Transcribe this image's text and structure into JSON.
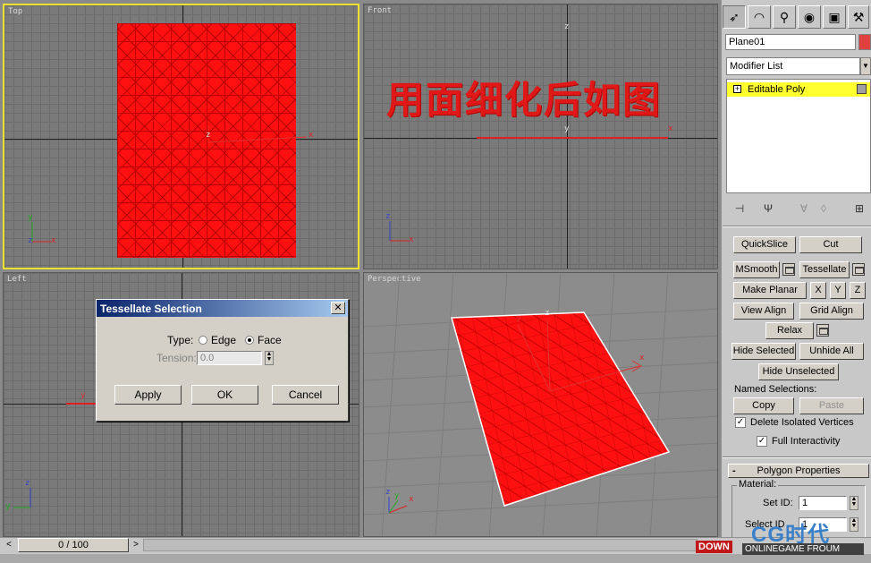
{
  "viewports": {
    "top": {
      "label": "Top"
    },
    "front": {
      "label": "Front"
    },
    "left": {
      "label": "Left"
    },
    "perspective": {
      "label": "Perspective"
    }
  },
  "axes": {
    "x": "x",
    "y": "y",
    "z": "z"
  },
  "overlay_caption": "用面细化后如图",
  "dialog": {
    "title": "Tessellate Selection",
    "close": "✕",
    "type_label": "Type:",
    "edge_label": "Edge",
    "face_label": "Face",
    "selected_type": "Face",
    "tension_label": "Tension:",
    "tension_value": "0.0",
    "apply": "Apply",
    "ok": "OK",
    "cancel": "Cancel"
  },
  "panel": {
    "object_name": "Plane01",
    "object_color": "#e04040",
    "modifier_list": "Modifier List",
    "stack_item": "Editable Poly",
    "plus": "+",
    "buttons": {
      "quickslice": "QuickSlice",
      "cut": "Cut",
      "msmooth": "MSmooth",
      "tessellate": "Tessellate",
      "make_planar": "Make Planar",
      "x": "X",
      "y": "Y",
      "z": "Z",
      "view_align": "View Align",
      "grid_align": "Grid Align",
      "relax": "Relax",
      "hide_selected": "Hide Selected",
      "unhide_all": "Unhide All",
      "hide_unselected": "Hide Unselected",
      "copy": "Copy",
      "paste": "Paste"
    },
    "named_selections": "Named Selections:",
    "delete_isolated": "Delete Isolated Vertices",
    "full_interactivity": "Full Interactivity",
    "rollout_minus": "-",
    "polygon_properties": "Polygon Properties",
    "material": "Material:",
    "set_id": "Set ID:",
    "set_id_value": "1",
    "select_id": "Select ID",
    "select_id_value": "1"
  },
  "timeline": {
    "frame": "0 / 100",
    "prev": "<",
    "next": ">"
  },
  "watermark": {
    "logo": "CG时代",
    "sub": "ONLINEGAME FROUM",
    "badge": "DOWN"
  },
  "accent_color": "#ff1010",
  "active_border": "#f0e030"
}
